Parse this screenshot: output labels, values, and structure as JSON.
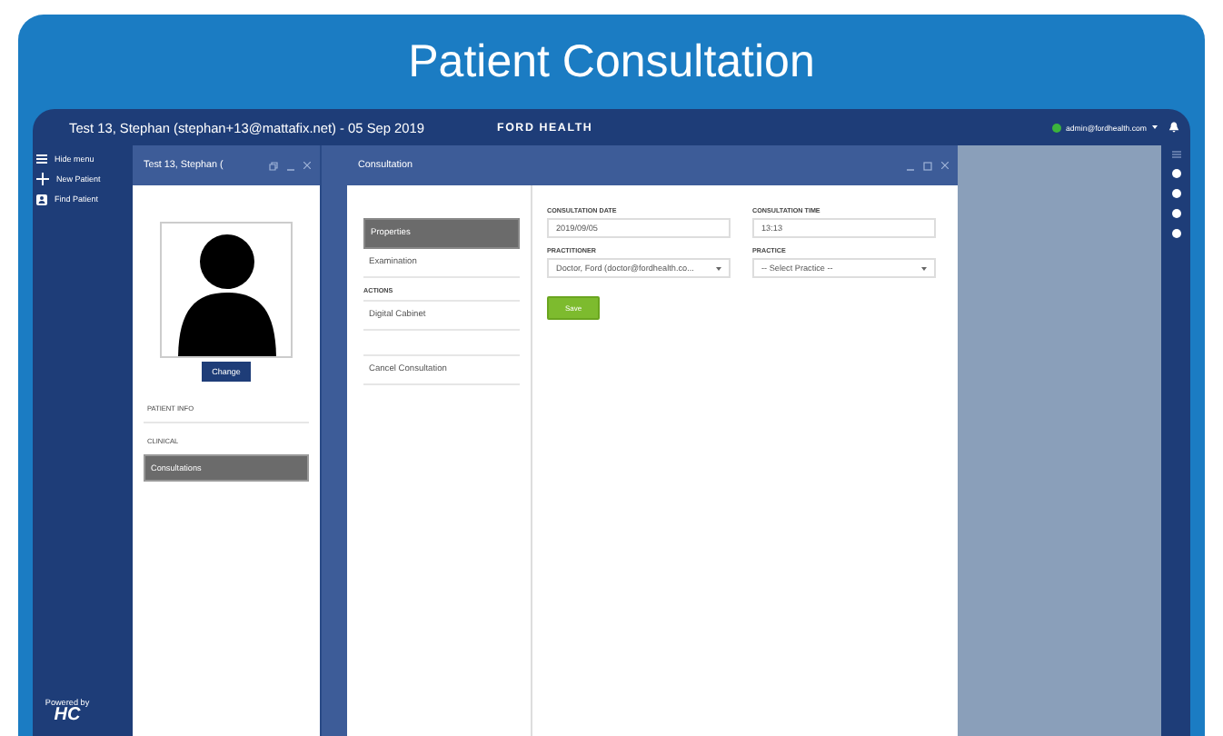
{
  "title": "Patient Consultation",
  "header": {
    "patient": "Test 13, Stephan (stephan+13@mattafix.net) - 05 Sep 2019",
    "brand": "FORD HEALTH",
    "user": "admin@fordhealth.com",
    "online": true
  },
  "nav": [
    {
      "kind": "menu",
      "label": "Hide menu"
    },
    {
      "kind": "add",
      "label": "New Patient"
    },
    {
      "kind": "find",
      "label": "Find Patient"
    }
  ],
  "patient_window": {
    "title": "Test 13, Stephan (",
    "photo_button": "Change",
    "items": [
      {
        "kind": "heading",
        "label": "PATIENT INFO"
      },
      {
        "kind": "subheading",
        "label": "CLINICAL"
      },
      {
        "kind": "item",
        "label": "Consultations",
        "selected": true
      }
    ]
  },
  "consultation_window": {
    "title": "Consultation",
    "menu": [
      {
        "kind": "item",
        "label": "Properties",
        "selected": true
      },
      {
        "kind": "item",
        "label": "Examination",
        "selected": false
      },
      {
        "kind": "heading",
        "label": "ACTIONS"
      },
      {
        "kind": "item",
        "label": "Digital Cabinet",
        "selected": false
      },
      {
        "kind": "action",
        "label": "Cancel Consultation",
        "selected": false
      }
    ],
    "fields": [
      {
        "kind": "text",
        "label": "CONSULTATION DATE",
        "value": "2019/09/05"
      },
      {
        "kind": "text",
        "label": "CONSULTATION TIME",
        "value": "13:13"
      },
      {
        "kind": "select",
        "label": "PRACTITIONER",
        "value": "Doctor, Ford (doctor@fordhealth.co..."
      },
      {
        "kind": "select",
        "label": "PRACTICE",
        "value": "-- Select Practice --"
      }
    ],
    "save_button": "Save"
  },
  "logo": {
    "caption": "Powered by",
    "mark": "HC"
  }
}
